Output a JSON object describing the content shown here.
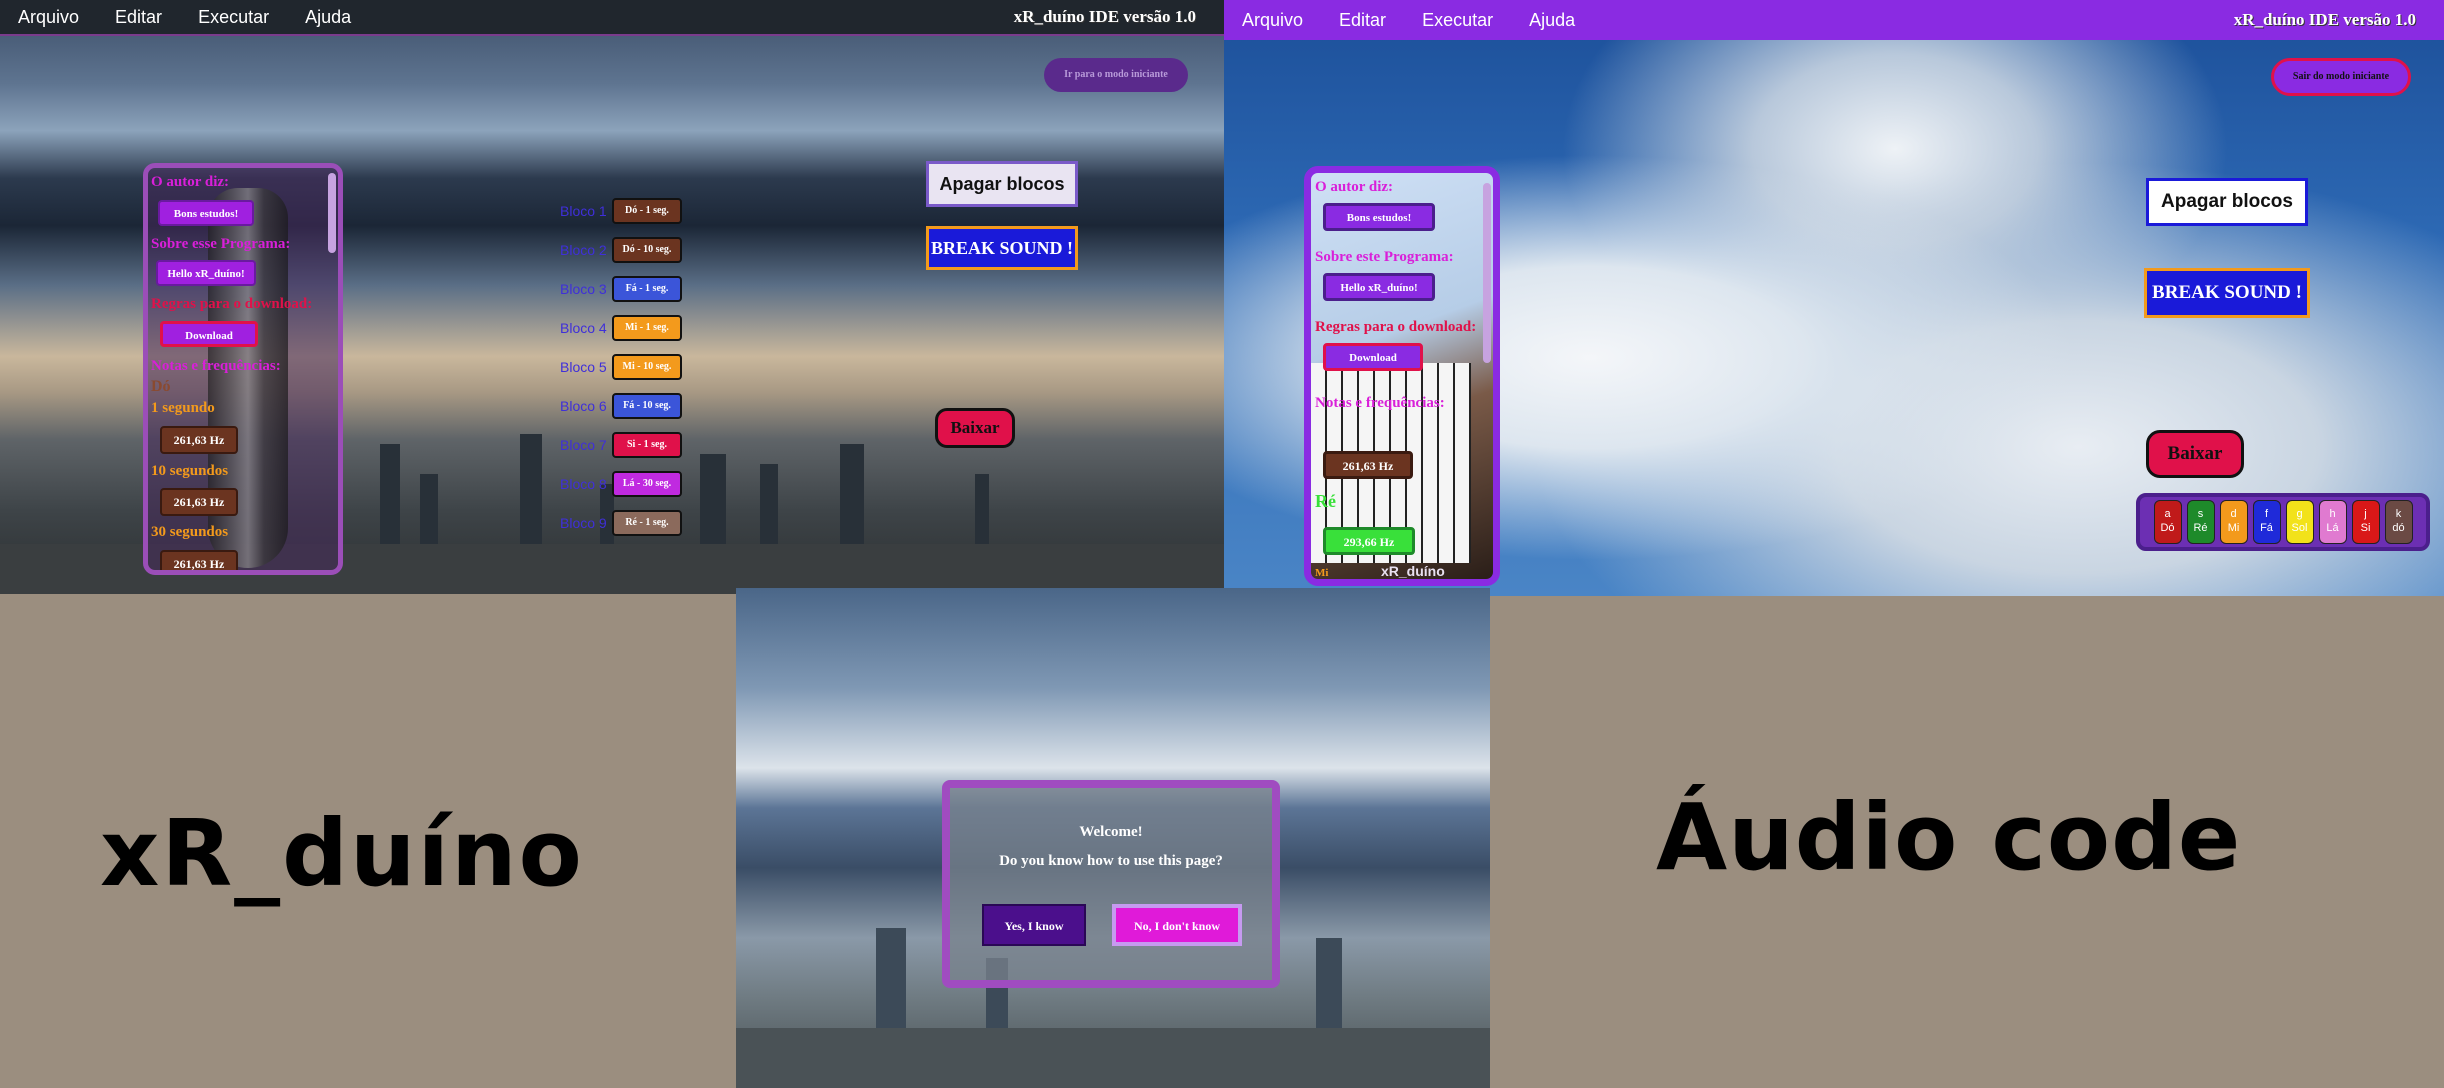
{
  "panel1": {
    "menu": [
      "Arquivo",
      "Editar",
      "Executar",
      "Ajuda"
    ],
    "version": "xR_duíno IDE versão 1.0",
    "mode_button": "Ir para o modo iniciante",
    "sidebar": {
      "author_heading": "O autor diz:",
      "author_button": "Bons estudos!",
      "about_heading": "Sobre esse Programa:",
      "about_button": "Hello xR_duíno!",
      "rules_heading": "Regras para o download:",
      "download_button": "Download",
      "notes_heading": "Notas e frequências:",
      "note_name": "Dó",
      "dur1": "1 segundo",
      "freq1": "261,63 Hz",
      "dur2": "10 segundos",
      "freq2": "261,63 Hz",
      "dur3": "30 segundos",
      "freq3": "261,63 Hz"
    },
    "blocks": [
      {
        "label": "Bloco 1",
        "value": "Dó - 1 seg.",
        "color": "#6b3420"
      },
      {
        "label": "Bloco 2",
        "value": "Dó - 10 seg.",
        "color": "#6b3420"
      },
      {
        "label": "Bloco 3",
        "value": "Fá - 1 seg.",
        "color": "#3b55d9"
      },
      {
        "label": "Bloco 4",
        "value": "Mi - 1 seg.",
        "color": "#f39a1c"
      },
      {
        "label": "Bloco 5",
        "value": "Mi - 10 seg.",
        "color": "#f39a1c"
      },
      {
        "label": "Bloco 6",
        "value": "Fá - 10 seg.",
        "color": "#3b55d9"
      },
      {
        "label": "Bloco 7",
        "value": "Si - 1 seg.",
        "color": "#e0114a"
      },
      {
        "label": "Bloco 8",
        "value": "Lá - 30 seg.",
        "color": "#c02ae0"
      },
      {
        "label": "Bloco 9",
        "value": "Ré - 1 seg.",
        "color": "#8b6a5c"
      }
    ],
    "clear_button": "Apagar blocos",
    "break_button": "BREAK SOUND !",
    "download_button": "Baixar"
  },
  "panel2": {
    "menu": [
      "Arquivo",
      "Editar",
      "Executar",
      "Ajuda"
    ],
    "version": "xR_duíno IDE versão 1.0",
    "mode_button": "Sair do modo iniciante",
    "sidebar": {
      "author_heading": "O autor diz:",
      "author_button": "Bons estudos!",
      "about_heading": "Sobre este Programa:",
      "about_button": "Hello xR_duíno!",
      "rules_heading": "Regras para o download:",
      "download_button": "Download",
      "notes_heading": "Notas e frequências:",
      "freq1": "261,63 Hz",
      "note2": "Ré",
      "freq2": "293,66 Hz",
      "note3": "Mi",
      "watermark": "xR_duíno"
    },
    "clear_button": "Apagar blocos",
    "break_button": "BREAK SOUND !",
    "download_button": "Baixar",
    "keys": [
      {
        "k": "a",
        "n": "Dó",
        "c": "#c01a1a"
      },
      {
        "k": "s",
        "n": "Ré",
        "c": "#1e8a2a"
      },
      {
        "k": "d",
        "n": "Mi",
        "c": "#f39a1c"
      },
      {
        "k": "f",
        "n": "Fá",
        "c": "#1f2ad9"
      },
      {
        "k": "g",
        "n": "Sol",
        "c": "#f2e21a"
      },
      {
        "k": "h",
        "n": "Lá",
        "c": "#e07ad0"
      },
      {
        "k": "j",
        "n": "Si",
        "c": "#d91818"
      },
      {
        "k": "k",
        "n": "dó",
        "c": "#6b4a44"
      }
    ]
  },
  "panel3": {
    "title": "Welcome!",
    "question": "Do you know how to use this page?",
    "yes": "Yes, I know",
    "no": "No, I don't know"
  },
  "labels": {
    "left": "xR_duíno",
    "right": "Áudio code"
  }
}
